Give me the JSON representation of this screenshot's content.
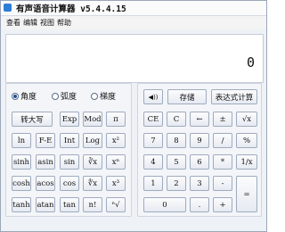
{
  "title": "有声语音计算器 v5.4.4.15",
  "menu": [
    "查看",
    "编辑",
    "视图",
    "帮助"
  ],
  "display": {
    "value": "0"
  },
  "angle_modes": [
    {
      "label": "角度",
      "selected": true
    },
    {
      "label": "弧度",
      "selected": false
    },
    {
      "label": "梯度",
      "selected": false
    }
  ],
  "sci_buttons": [
    [
      "转大写",
      "Exp",
      "Mod",
      "π"
    ],
    [
      "ln",
      "F-E",
      "Int",
      "Log",
      "x²"
    ],
    [
      "sinh",
      "asin",
      "sin",
      "∛x",
      "xⁿ"
    ],
    [
      "cosh",
      "acos",
      "cos",
      "∜x",
      "x³"
    ],
    [
      "tanh",
      "atan",
      "tan",
      "n!",
      "ⁿ√"
    ]
  ],
  "std_top": {
    "speaker": "◀))",
    "store": "存储",
    "expression": "表达式计算"
  },
  "std_buttons": [
    [
      "CE",
      "C",
      "←",
      "±",
      "√x"
    ],
    [
      "7",
      "8",
      "9",
      "/",
      "%"
    ],
    [
      "4",
      "5",
      "6",
      "*",
      "1/x"
    ],
    [
      "1",
      "2",
      "3",
      "-",
      "="
    ],
    [
      "0",
      ".",
      "+"
    ]
  ]
}
